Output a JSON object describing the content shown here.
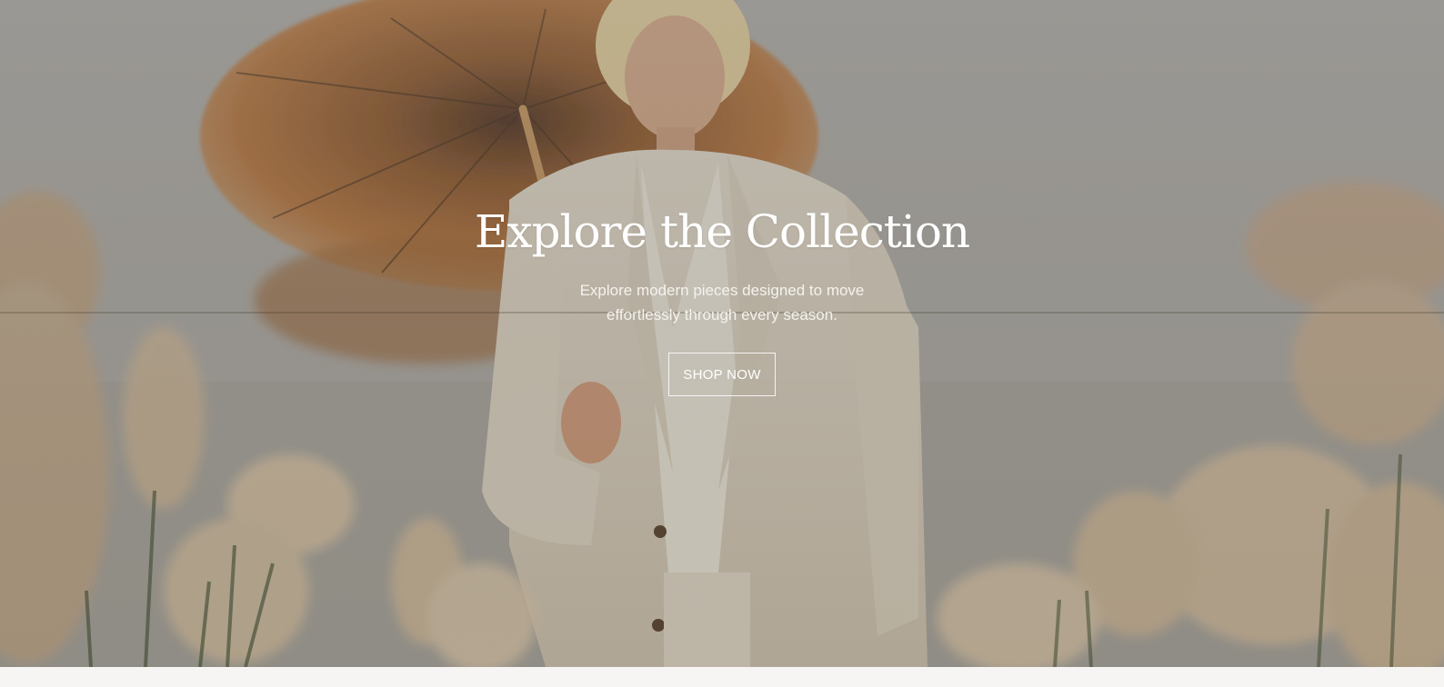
{
  "hero": {
    "title": "Explore the Collection",
    "subtitle_line1": "Explore modern pieces designed to move",
    "subtitle_line2": "effortlessly through every season.",
    "cta_label": "SHOP NOW",
    "image_alt": "Model in cream suit holding straw umbrella in a pampas grass field"
  },
  "colors": {
    "overlay": "#9a9894",
    "text": "#ffffff",
    "page_background": "#f6f5f3"
  }
}
